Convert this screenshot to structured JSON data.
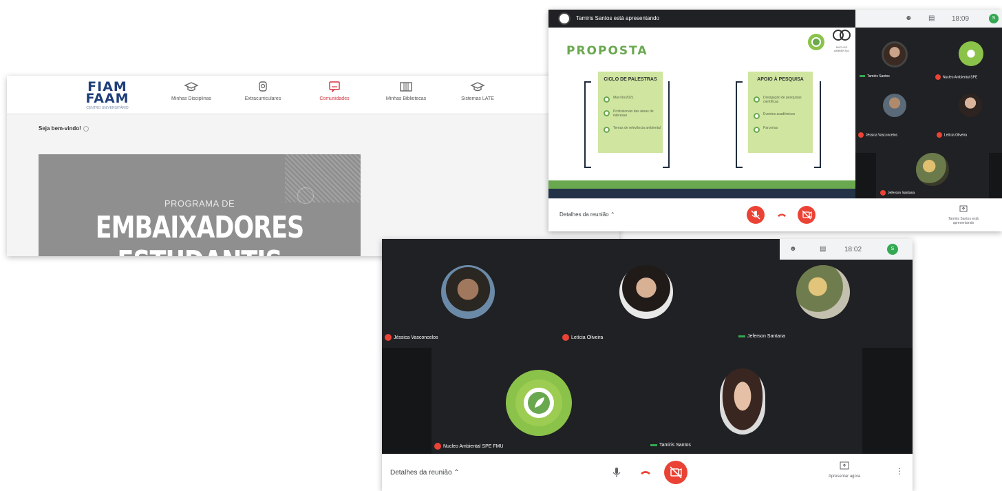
{
  "portal": {
    "logo_line1": "FIAM",
    "logo_line2": "FAAM",
    "logo_tagline": "CENTRO UNIVERSITÁRIO",
    "nav": [
      {
        "label": "Minhas Disciplinas",
        "icon": "graduation-cap-icon",
        "active": false
      },
      {
        "label": "Extracurriculares",
        "icon": "badge-icon",
        "active": false
      },
      {
        "label": "Comunidades",
        "icon": "chat-icon",
        "active": true
      },
      {
        "label": "Minhas Bibliotecas",
        "icon": "books-icon",
        "active": false
      },
      {
        "label": "Sistemas LATE",
        "icon": "graduation-cap-icon",
        "active": false
      }
    ],
    "welcome": "Seja bem-vindo!",
    "banner": {
      "subtitle": "PROGRAMA DE",
      "title": "EMBAIXADORES ESTUDANTIS"
    },
    "accent_color": "#d4343f"
  },
  "meet1": {
    "presenter_banner": "Tamiris Santos está apresentando",
    "time": "18:09",
    "slide": {
      "title": "PROPOSTA",
      "logo_text": "NÚCLEO AMBIENTAL",
      "cards": [
        {
          "heading": "CICLO DE PALESTRAS",
          "items": [
            "Mar√ßo/2021",
            "Profissionais das áreas de interesse",
            "Temas de relevância ambiental"
          ]
        },
        {
          "heading": "APOIO À PESQUISA",
          "items": [
            "Divulgação de pesquisas científicas",
            "Eventos acadêmicos",
            "Parcerias"
          ]
        }
      ]
    },
    "participants": [
      {
        "name": "Tamiris Santos",
        "muted": false
      },
      {
        "name": "Nucleo Ambiental SPE",
        "muted": true
      },
      {
        "name": "Jéssica Vasconcelos",
        "muted": true
      },
      {
        "name": "Letícia Oliveira",
        "muted": true
      },
      {
        "name": "Jeferson Santana",
        "muted": true
      }
    ],
    "details_label": "Detalhes da reunião",
    "present_label": "Tamiris Santos está apresentando"
  },
  "meet2": {
    "time": "18:02",
    "participants": [
      {
        "name": "Jéssica Vasconcelos",
        "muted": true
      },
      {
        "name": "Letícia Oliveira",
        "muted": true
      },
      {
        "name": "Jeferson Santana",
        "muted": false
      },
      {
        "name": "Nucleo Ambiental SPE FMU",
        "muted": true
      },
      {
        "name": "Tamiris Santos",
        "muted": false
      }
    ],
    "details_label": "Detalhes da reunião",
    "present_label": "Apresentar agora"
  },
  "colors": {
    "meet_dark": "#202124",
    "meet_red": "#ea4335",
    "meet_green": "#34a853",
    "slide_green": "#6aa84f",
    "slide_card": "#cfe5a0",
    "slide_navy": "#233247"
  }
}
